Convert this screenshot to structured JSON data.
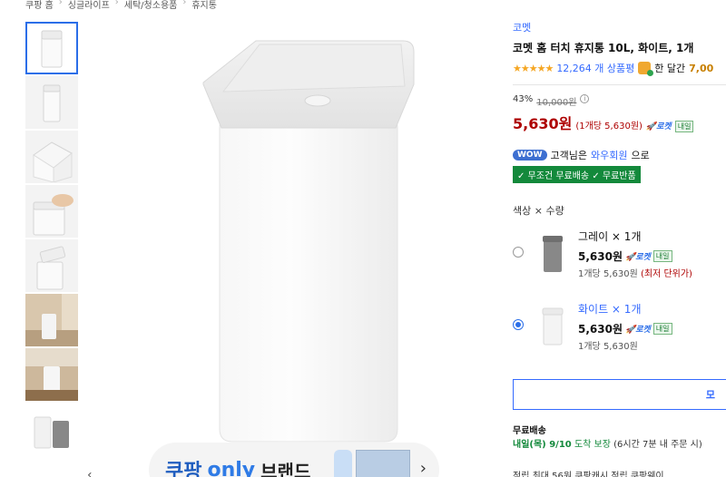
{
  "breadcrumb": [
    "쿠팡 홈",
    "싱글라이프",
    "세탁/청소용품",
    "휴지통"
  ],
  "thumbnails": [
    {
      "kind": "bin-front",
      "selected": true
    },
    {
      "kind": "bin-side",
      "selected": false
    },
    {
      "kind": "bin-top",
      "selected": false
    },
    {
      "kind": "hand-press",
      "selected": false
    },
    {
      "kind": "bin-open",
      "selected": false
    },
    {
      "kind": "room-photo-1",
      "selected": false
    },
    {
      "kind": "room-photo-2",
      "selected": false
    },
    {
      "kind": "white-gray-pair",
      "selected": false
    }
  ],
  "banner": {
    "part1": "쿠팡",
    "part2": "only",
    "part3": "브랜드"
  },
  "product": {
    "brand": "코멧",
    "title": "코멧 홈 터치 휴지통 10L, 화이트, 1개",
    "review_count": "12,264 개 상품평",
    "month_text": "한 달간",
    "month_num": "7,00",
    "discount": "43%",
    "original_price": "10,000원",
    "price": "5,630원",
    "unit_price": "(1개당 5,630원)",
    "rocket": "로켓",
    "tomorrow": "내일"
  },
  "wow": {
    "badge": "WOW",
    "text1": "고객님은",
    "link": "와우회원",
    "text2": "으로"
  },
  "free_badges": "✓ 무조건 무료배송  ✓ 무료반품",
  "options": {
    "heading": "색상 × 수량",
    "items": [
      {
        "name": "그레이 × 1개",
        "price": "5,630원",
        "sub": "1개당 5,630원",
        "note": "(최저 단위가)",
        "selected": false,
        "color": "#8a8a8a"
      },
      {
        "name": "화이트 × 1개",
        "price": "5,630원",
        "sub": "1개당 5,630원",
        "note": "",
        "selected": true,
        "color": "#f2f2f2"
      }
    ]
  },
  "buy_button": "모",
  "shipping": {
    "label": "무료배송",
    "date": "내일(목) 9/10",
    "date_suffix": "도착 보장",
    "note": "(6시간 7분 내 주문 시)"
  },
  "bottom_row": "적립      최대 56원 쿠팡캐시 적립    쿠팡웨이"
}
